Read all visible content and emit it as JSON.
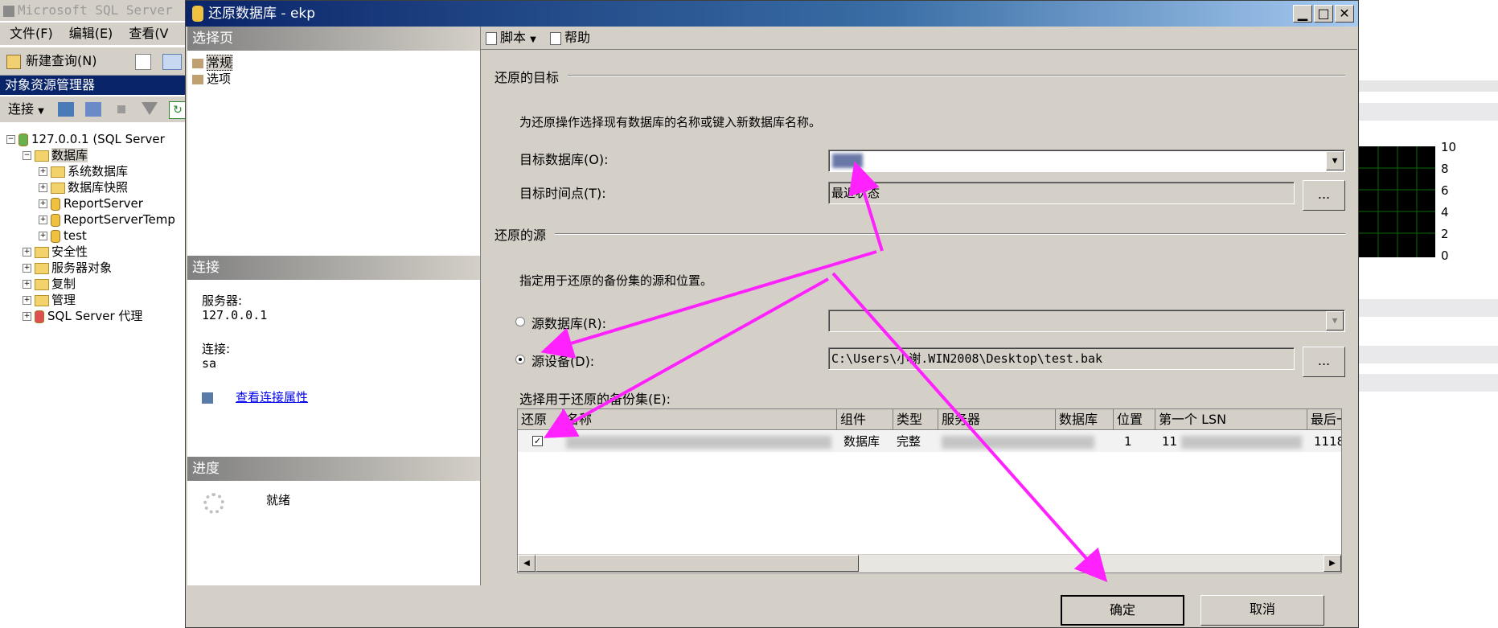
{
  "ssms": {
    "title": "Microsoft SQL Server",
    "menu": [
      "文件(F)",
      "编辑(E)",
      "查看(V"
    ],
    "new_query": "新建查询(N)",
    "object_explorer_title": "对象资源管理器",
    "connect_label": "连接",
    "tree": {
      "server": "127.0.0.1 (SQL Server",
      "databases": "数据库",
      "db_children": [
        "系统数据库",
        "数据库快照",
        "ReportServer",
        "ReportServerTemp",
        "test"
      ],
      "siblings": [
        "安全性",
        "服务器对象",
        "复制",
        "管理",
        "SQL Server 代理"
      ]
    }
  },
  "chart_ticks": [
    "10",
    "8",
    "6",
    "4",
    "2",
    "0"
  ],
  "dialog": {
    "title": "还原数据库 - ekp",
    "left": {
      "select_page_header": "选择页",
      "pages": [
        "常规",
        "选项"
      ],
      "connection_header": "连接",
      "server_label": "服务器:",
      "server_value": "127.0.0.1",
      "connection_label": "连接:",
      "connection_value": "sa",
      "view_props_link": "查看连接属性",
      "progress_header": "进度",
      "progress_status": "就绪"
    },
    "toolbar": {
      "script": "脚本",
      "help": "帮助"
    },
    "destination": {
      "group_title": "还原的目标",
      "description": "为还原操作选择现有数据库的名称或键入新数据库名称。",
      "target_db_label": "目标数据库(O):",
      "target_db_value": "",
      "target_time_label": "目标时间点(T):",
      "target_time_value": "最近状态"
    },
    "source": {
      "group_title": "还原的源",
      "description": "指定用于还原的备份集的源和位置。",
      "source_db_label": "源数据库(R):",
      "source_device_label": "源设备(D):",
      "source_device_value": "C:\\Users\\小谢.WIN2008\\Desktop\\test.bak",
      "backupset_label": "选择用于还原的备份集(E):"
    },
    "grid": {
      "columns": [
        "还原",
        "名称",
        "组件",
        "类型",
        "服务器",
        "数据库",
        "位置",
        "第一个 LSN",
        "最后一"
      ],
      "row": {
        "component": "数据库",
        "type": "完整",
        "position": "1",
        "first_lsn": "11",
        "last_lsn": "1118"
      }
    },
    "buttons": {
      "ok": "确定",
      "cancel": "取消",
      "browse": "..."
    }
  }
}
